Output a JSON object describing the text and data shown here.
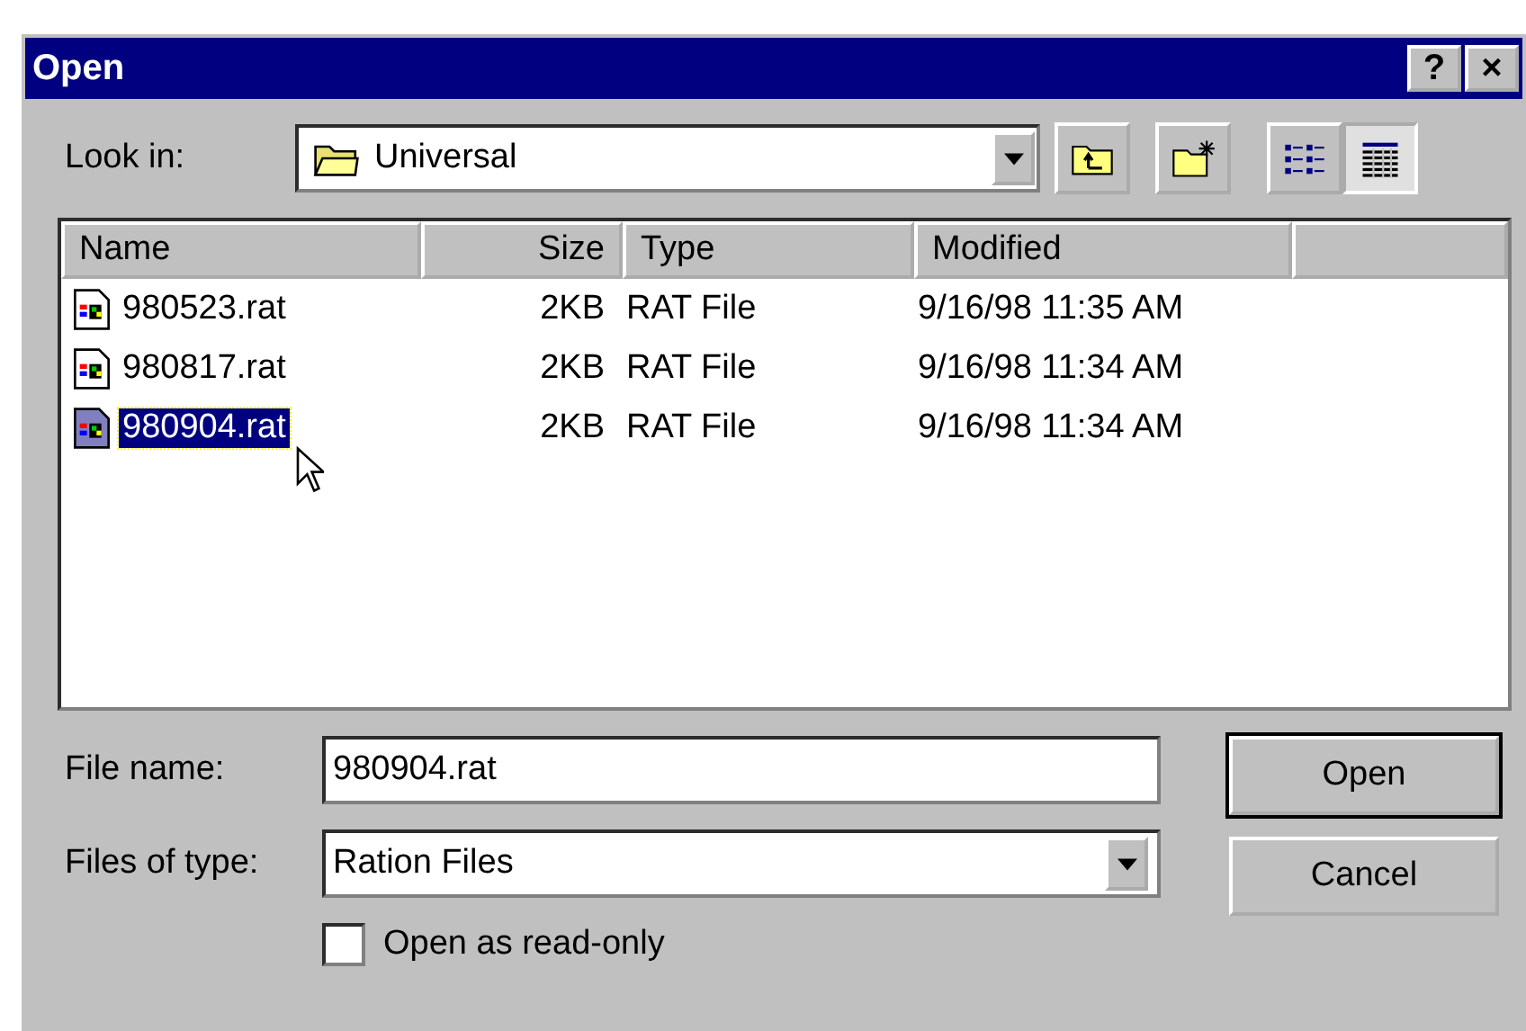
{
  "window": {
    "title": "Open",
    "title_buttons": [
      "?",
      "×"
    ]
  },
  "look_in": {
    "label": "Look in:",
    "value": "Universal"
  },
  "toolbar": [
    {
      "kind": "up-folder",
      "selected": false
    },
    {
      "kind": "new-folder",
      "selected": false
    },
    {
      "kind": "list-view",
      "selected": false
    },
    {
      "kind": "details-view",
      "selected": true
    }
  ],
  "file_list": {
    "columns": [
      "Name",
      "Size",
      "Type",
      "Modified"
    ],
    "rows": [
      {
        "name": "980523.rat",
        "size": "2KB",
        "type": "RAT File",
        "modified": "9/16/98 11:35 AM",
        "selected": false
      },
      {
        "name": "980817.rat",
        "size": "2KB",
        "type": "RAT File",
        "modified": "9/16/98 11:34 AM",
        "selected": false
      },
      {
        "name": "980904.rat",
        "size": "2KB",
        "type": "RAT File",
        "modified": "9/16/98 11:34 AM",
        "selected": true
      }
    ]
  },
  "file_name": {
    "label": "File name:",
    "value": "980904.rat"
  },
  "file_type": {
    "label": "Files of type:",
    "value": "Ration Files"
  },
  "buttons": [
    {
      "label": "Open",
      "default": true
    },
    {
      "label": "Cancel",
      "default": false
    }
  ],
  "read_only": {
    "label": "Open as read-only",
    "checked": false
  }
}
